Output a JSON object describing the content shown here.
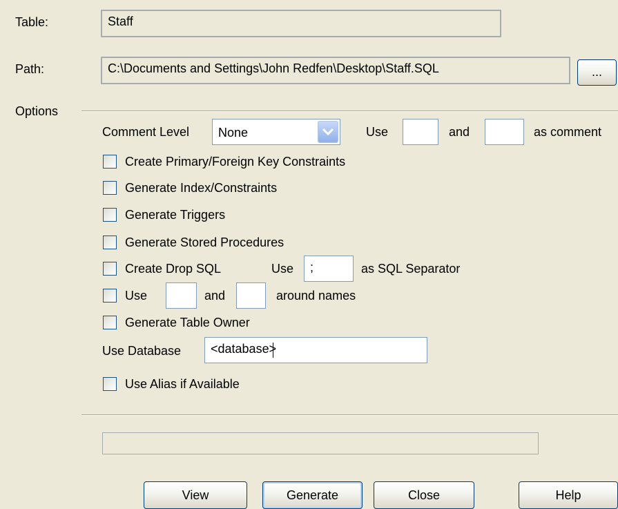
{
  "table": {
    "label": "Table:",
    "value": "Staff"
  },
  "path": {
    "label": "Path:",
    "value": "C:\\Documents and Settings\\John Redfen\\Desktop\\Staff.SQL",
    "browse_label": "..."
  },
  "options": {
    "label": "Options",
    "comment_level": {
      "label": "Comment Level",
      "value": "None"
    },
    "comment_use_label": "Use",
    "comment_and_label": "and",
    "comment_suffix_label": "as comment",
    "comment_start": "",
    "comment_end": "",
    "checkboxes": {
      "pk_fk": "Create Primary/Foreign Key Constraints",
      "index": "Generate Index/Constraints",
      "triggers": "Generate Triggers",
      "stored_procs": "Generate Stored Procedures",
      "drop_sql": "Create Drop SQL",
      "use_names": "Use",
      "table_owner": "Generate Table Owner",
      "alias": "Use Alias if Available"
    },
    "drop_sql_use_label": "Use",
    "sql_separator_value": ";",
    "sql_separator_suffix": "as SQL Separator",
    "names_and_label": "and",
    "names_suffix": "around names",
    "names_start": "",
    "names_end": "",
    "use_database": {
      "label": "Use Database",
      "value": "<database>"
    }
  },
  "progress": {
    "value": 0
  },
  "buttons": {
    "view": "View",
    "generate": "Generate",
    "close": "Close",
    "help": "Help"
  },
  "colors": {
    "background": "#ece9d8",
    "field_border": "#7f9db9",
    "checkbox_border": "#1c5180",
    "dropdown_arrow": "#8fb0ea"
  },
  "icons": {
    "dropdown": "chevron-down-icon"
  }
}
